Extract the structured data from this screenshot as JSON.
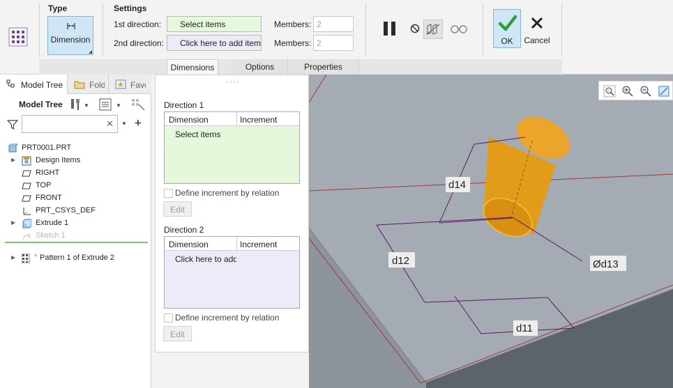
{
  "ribbon": {
    "feature_icon": "pattern-grid-icon",
    "type_group": {
      "title": "Type",
      "button_label": "Dimension",
      "icon": "dimension-icon"
    },
    "settings_group": {
      "title": "Settings",
      "first_direction_label": "1st direction:",
      "first_direction_value": "Select items",
      "second_direction_label": "2nd direction:",
      "second_direction_value": "Click here to add item",
      "members_label_1": "Members:",
      "members_value_1": "2",
      "members_label_2": "Members:",
      "members_value_2": "2"
    },
    "tools": [
      "pause-icon",
      "no-entry-icon",
      "preview-pattern-icon",
      "glasses-icon"
    ],
    "ok_label": "OK",
    "cancel_label": "Cancel",
    "tabs": [
      {
        "label": "Dimensions",
        "active": true
      },
      {
        "label": "Options",
        "active": false
      },
      {
        "label": "Properties",
        "active": false
      }
    ],
    "colors": {
      "accent": "#cfe6f7",
      "collector_active": "#e5f8dc",
      "collector_inactive": "#eeeaf7",
      "ok_check": "#2e9e3d"
    }
  },
  "left_panel": {
    "tabs": [
      {
        "label": "Model Tree",
        "icon": "model-tree-icon"
      },
      {
        "label": "Folder Browser",
        "icon": "folder-icon"
      },
      {
        "label": "Favorites",
        "icon": "favorites-icon"
      }
    ],
    "toolbar_label": "Model Tree",
    "filter_placeholder": "",
    "items": [
      {
        "label": "PRT0001.PRT",
        "icon": "part-icon",
        "expandable": false,
        "greyed": false
      },
      {
        "label": "Design Items",
        "icon": "design-items-icon",
        "expandable": true,
        "greyed": false
      },
      {
        "label": "RIGHT",
        "icon": "datum-plane-icon",
        "expandable": false,
        "greyed": false
      },
      {
        "label": "TOP",
        "icon": "datum-plane-icon",
        "expandable": false,
        "greyed": false
      },
      {
        "label": "FRONT",
        "icon": "datum-plane-icon",
        "expandable": false,
        "greyed": false
      },
      {
        "label": "PRT_CSYS_DEF",
        "icon": "csys-icon",
        "expandable": false,
        "greyed": false
      },
      {
        "label": "Extrude 1",
        "icon": "extrude-icon",
        "expandable": true,
        "greyed": false
      },
      {
        "label": "Sketch 1",
        "icon": "sketch-icon",
        "expandable": false,
        "greyed": true
      },
      {
        "label": "Pattern 1 of Extrude 2",
        "icon": "pattern-icon",
        "expandable": true,
        "greyed": false
      }
    ]
  },
  "dimensions_panel": {
    "direction1": {
      "title": "Direction 1",
      "col_dimension": "Dimension",
      "col_increment": "Increment",
      "placeholder": "Select items",
      "relation_label": "Define increment by relation",
      "edit_label": "Edit"
    },
    "direction2": {
      "title": "Direction 2",
      "col_dimension": "Dimension",
      "col_increment": "Increment",
      "placeholder": "Click here to add item",
      "relation_label": "Define increment by relation",
      "edit_label": "Edit"
    }
  },
  "viewport": {
    "dims": [
      "d14",
      "d12",
      "Ød13",
      "d11"
    ],
    "tools": [
      "zoom-area-icon",
      "zoom-in-icon",
      "zoom-out-icon",
      "refit-icon"
    ],
    "colors": {
      "cylinder": "#e39b1a",
      "dimension_line": "#5a1a6a",
      "block_top": "#a5abb3",
      "block_side": "#5d636a"
    }
  }
}
